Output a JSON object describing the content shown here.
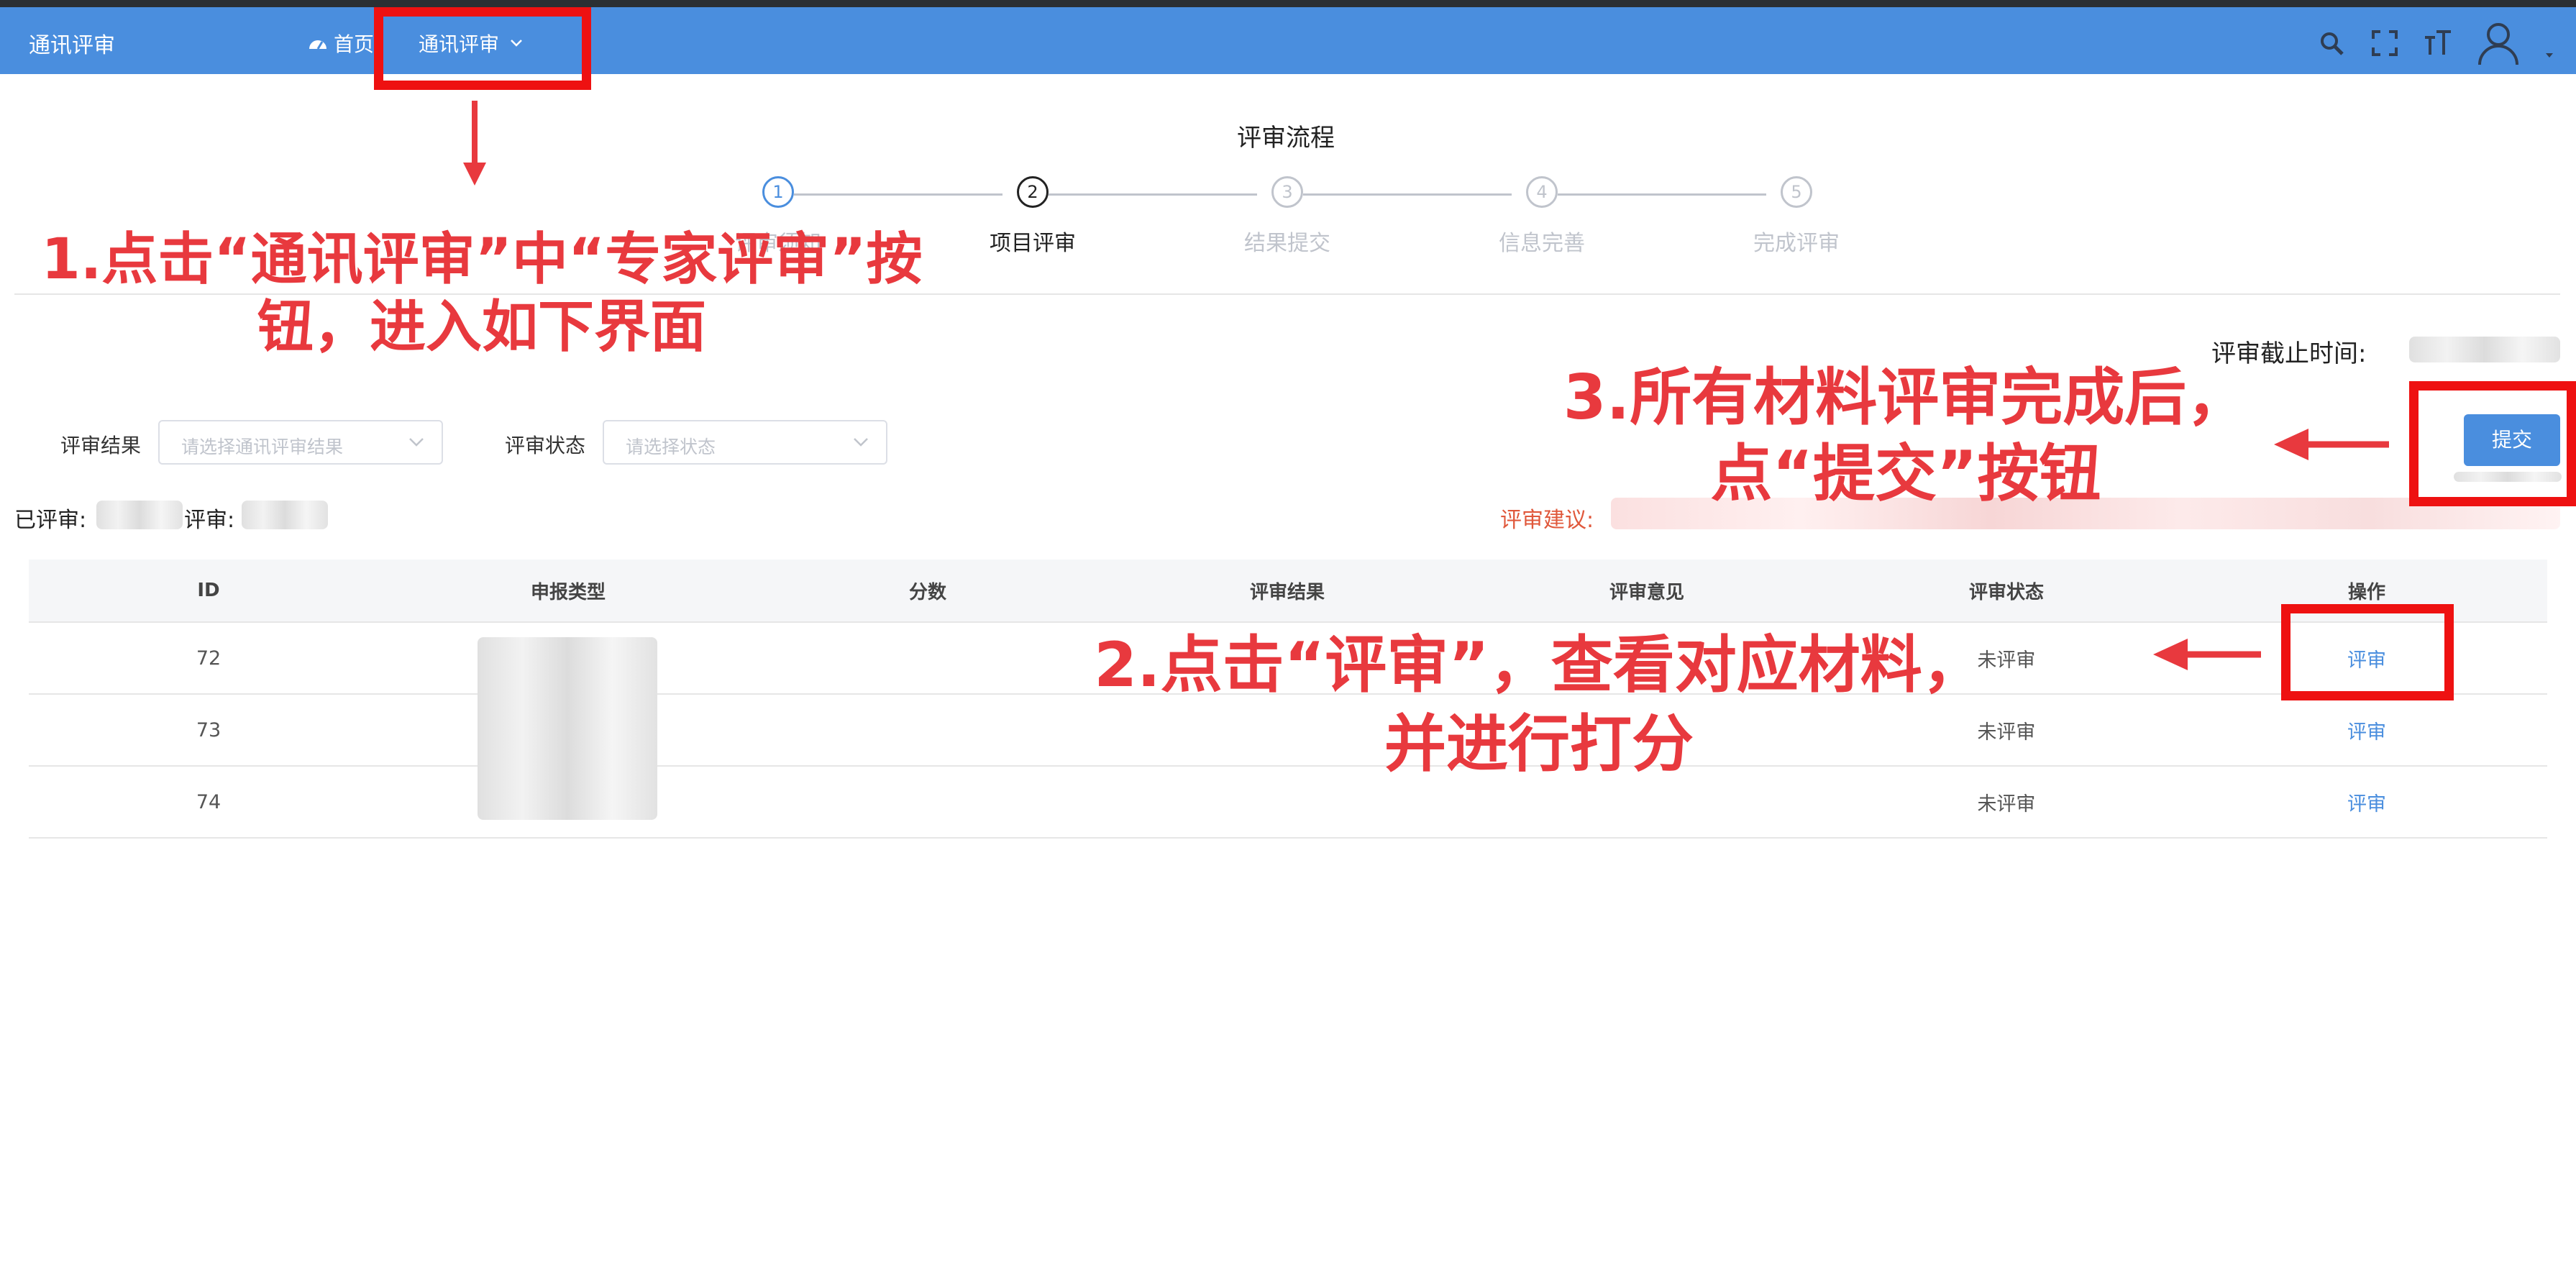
{
  "navbar": {
    "brand": "通讯评审",
    "home_label": "首页",
    "menu_label": "通讯评审",
    "menu_chevron_icon": "chevron-down-icon",
    "icons": [
      "search-icon",
      "fullscreen-icon",
      "font-size-icon",
      "user-avatar-icon",
      "caret-down-icon"
    ]
  },
  "steps": {
    "title": "评审流程",
    "items": [
      {
        "num": "1",
        "label": "评审须知"
      },
      {
        "num": "2",
        "label": "项目评审"
      },
      {
        "num": "3",
        "label": "结果提交"
      },
      {
        "num": "4",
        "label": "信息完善"
      },
      {
        "num": "5",
        "label": "完成评审"
      }
    ],
    "active_index": 2
  },
  "deadline_label": "评审截止时间:",
  "filters": {
    "result_label": "评审结果",
    "result_placeholder": "请选择通讯评审结果",
    "status_label": "评审状态",
    "status_placeholder": "请选择状态"
  },
  "submit_label": "提交",
  "counts": {
    "reviewed_label": "已评审:",
    "unreviewed_label": "评审:"
  },
  "suggestion_label": "评审建议:",
  "table": {
    "headers": [
      "ID",
      "申报类型",
      "分数",
      "评审结果",
      "评审意见",
      "评审状态",
      "操作"
    ],
    "rows": [
      {
        "id": "72",
        "status": "未评审",
        "action": "评审"
      },
      {
        "id": "73",
        "status": "未评审",
        "action": "评审"
      },
      {
        "id": "74",
        "status": "未评审",
        "action": "评审"
      }
    ]
  },
  "annotations": {
    "a1_line1": "1.点击“通讯评审”中“专家评审”按",
    "a1_line2": "钮，进入如下界面",
    "a2_line1": "2.点击“评审”，查看对应材料，",
    "a2_line2": "并进行打分",
    "a3_line1": "3.所有材料评审完成后，",
    "a3_line2": "点“提交”按钮"
  },
  "colors": {
    "navbar": "#4a8ede",
    "annotation_red": "#e8393e",
    "highlight_box": "#ee1111",
    "link": "#4a8ede"
  }
}
